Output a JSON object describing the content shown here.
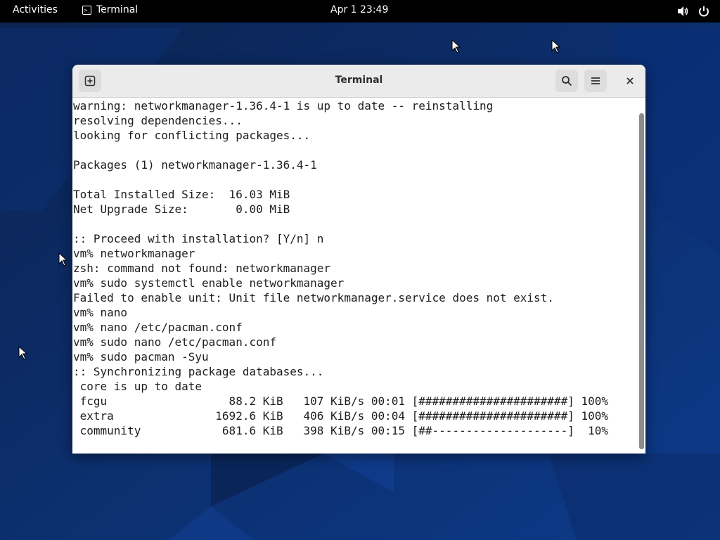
{
  "topbar": {
    "activities": "Activities",
    "app_name": "Terminal",
    "clock": "Apr 1  23:49",
    "icons": [
      "volume-icon",
      "power-icon"
    ]
  },
  "window": {
    "title": "Terminal",
    "buttons": [
      "new-tab-icon",
      "search-icon",
      "menu-icon",
      "close-icon"
    ]
  },
  "terminal": {
    "lines": [
      "warning: networkmanager-1.36.4-1 is up to date -- reinstalling",
      "resolving dependencies...",
      "looking for conflicting packages...",
      "",
      "Packages (1) networkmanager-1.36.4-1",
      "",
      "Total Installed Size:  16.03 MiB",
      "Net Upgrade Size:       0.00 MiB",
      "",
      ":: Proceed with installation? [Y/n] n",
      "vm% networkmanager",
      "zsh: command not found: networkmanager",
      "vm% sudo systemctl enable networkmanager",
      "Failed to enable unit: Unit file networkmanager.service does not exist.",
      "vm% nano",
      "vm% nano /etc/pacman.conf",
      "vm% sudo nano /etc/pacman.conf",
      "vm% sudo pacman -Syu",
      ":: Synchronizing package databases...",
      " core is up to date",
      " fcgu                  88.2 KiB   107 KiB/s 00:01 [######################] 100%",
      " extra               1692.6 KiB   406 KiB/s 00:04 [######################] 100%",
      " community            681.6 KiB   398 KiB/s 00:15 [##--------------------]  10%"
    ]
  },
  "colors": {
    "desktop_bg": "#0a2a5e",
    "topbar_bg": "#000000",
    "headerbar_bg": "#ebebeb"
  }
}
